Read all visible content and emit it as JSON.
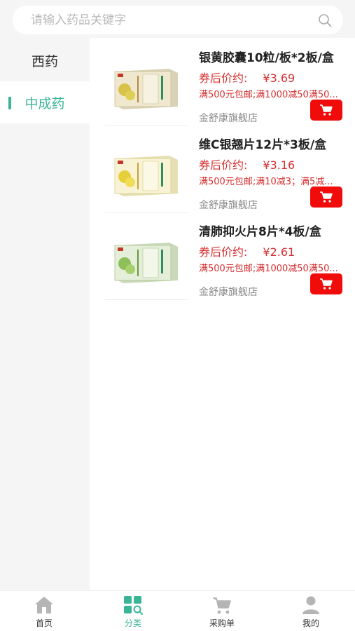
{
  "search": {
    "placeholder": "请输入药品关键字"
  },
  "categories": [
    {
      "label": "西药",
      "active": false
    },
    {
      "label": "中成药",
      "active": true
    }
  ],
  "products": [
    {
      "title": "银黄胶囊10粒/板*2板/盒",
      "price_label": "券后价约:",
      "price": "¥3.69",
      "promo": "满500元包邮;满1000减50满50...",
      "shop": "金舒康旗舰店",
      "box_color": "#e9dfc0",
      "panel_color": "#d9cf9f"
    },
    {
      "title": "维C银翘片12片*3板/盒",
      "price_label": "券后价约:",
      "price": "¥3.16",
      "promo": "满500元包邮;满10减3；满5减...",
      "shop": "金舒康旗舰店",
      "box_color": "#f6f0c8",
      "panel_color": "#efe48e"
    },
    {
      "title": "清肺抑火片8片*4板/盒",
      "price_label": "券后价约:",
      "price": "¥2.61",
      "promo": "满500元包邮;满1000减50满50...",
      "shop": "金舒康旗舰店",
      "box_color": "#e2ecd6",
      "panel_color": "#a9c98f"
    }
  ],
  "tabs": [
    {
      "label": "首页",
      "icon": "home-icon",
      "active": false
    },
    {
      "label": "分类",
      "icon": "category-icon",
      "active": true
    },
    {
      "label": "采购单",
      "icon": "cart-icon",
      "active": false
    },
    {
      "label": "我的",
      "icon": "user-icon",
      "active": false
    }
  ],
  "colors": {
    "accent": "#3ab497",
    "price": "#d63031",
    "cart_button": "#f10c0c",
    "tab_inactive_icon": "#b5b5b5"
  }
}
